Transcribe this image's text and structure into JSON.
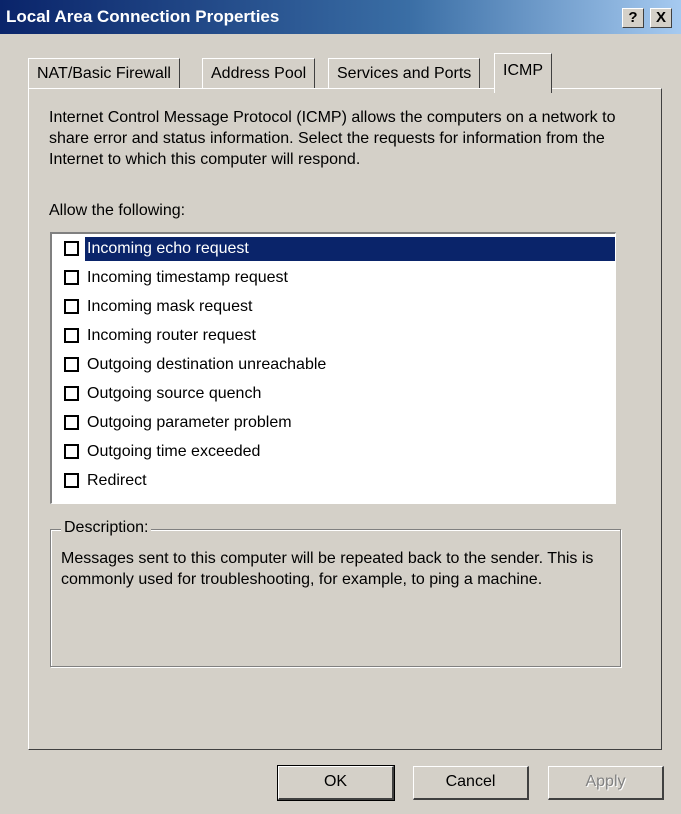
{
  "window": {
    "title": "Local Area Connection Properties",
    "help_label": "?",
    "close_label": "X"
  },
  "tabs": [
    {
      "label": "NAT/Basic Firewall",
      "active": false
    },
    {
      "label": "Address Pool",
      "active": false
    },
    {
      "label": "Services and Ports",
      "active": false
    },
    {
      "label": "ICMP",
      "active": true
    }
  ],
  "icmp": {
    "intro": "Internet Control Message Protocol (ICMP) allows the computers on a network to share error and status information. Select the requests for information from the Internet to which this computer will respond.",
    "allow_label": "Allow the following:",
    "items": [
      {
        "label": "Incoming echo request",
        "checked": false,
        "selected": true
      },
      {
        "label": "Incoming timestamp request",
        "checked": false,
        "selected": false
      },
      {
        "label": "Incoming mask request",
        "checked": false,
        "selected": false
      },
      {
        "label": "Incoming router request",
        "checked": false,
        "selected": false
      },
      {
        "label": "Outgoing destination unreachable",
        "checked": false,
        "selected": false
      },
      {
        "label": "Outgoing source quench",
        "checked": false,
        "selected": false
      },
      {
        "label": "Outgoing parameter problem",
        "checked": false,
        "selected": false
      },
      {
        "label": "Outgoing time exceeded",
        "checked": false,
        "selected": false
      },
      {
        "label": "Redirect",
        "checked": false,
        "selected": false
      }
    ],
    "description_title": "Description:",
    "description_text": "Messages sent to this computer will be repeated back to the sender. This is commonly used for troubleshooting, for example, to ping a machine."
  },
  "buttons": {
    "ok": "OK",
    "cancel": "Cancel",
    "apply": "Apply"
  },
  "colors": {
    "title_bar": "#0a246a",
    "selection": "#0a246a",
    "face": "#d4d0c8"
  }
}
